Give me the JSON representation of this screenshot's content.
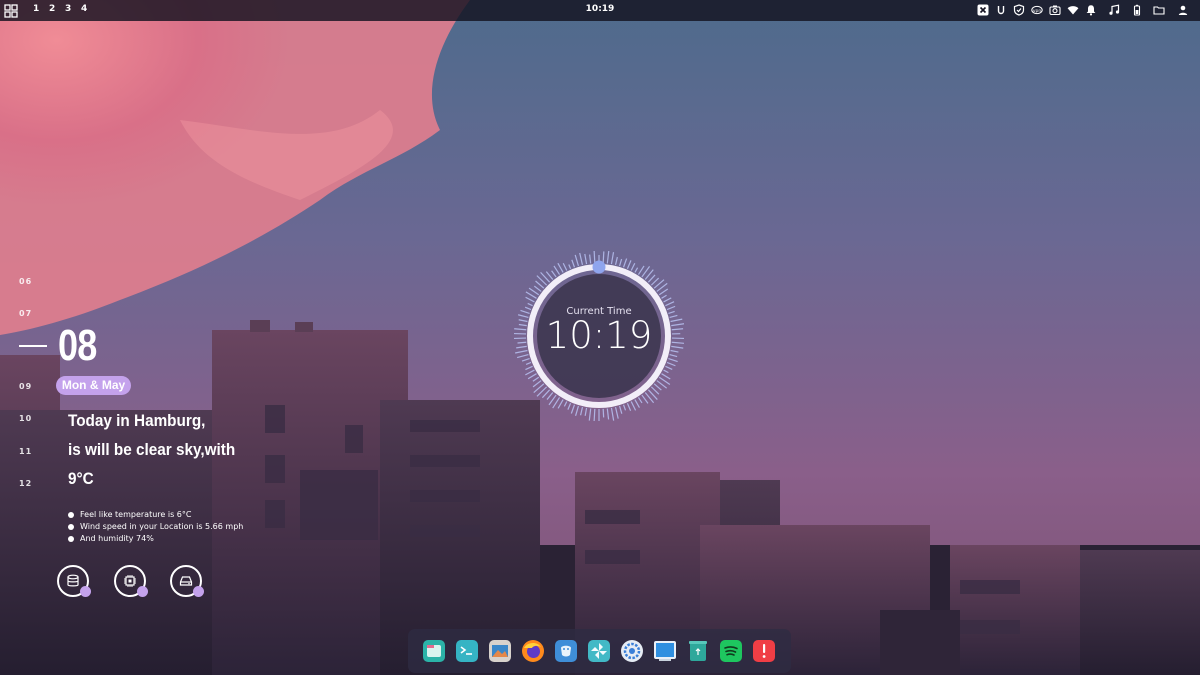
{
  "top_bar": {
    "workspaces": [
      "1",
      "2",
      "3",
      "4"
    ],
    "clock": "10:19",
    "tray_icons": [
      "x-app-icon",
      "u-app-icon",
      "shield-icon",
      "vpn-icon",
      "screenshot-icon",
      "wifi-icon",
      "bell-icon",
      "music-icon",
      "battery-icon",
      "folder-icon",
      "user-icon"
    ]
  },
  "calendar_widget": {
    "day_ticks": [
      "06",
      "07",
      "09",
      "10",
      "11",
      "12"
    ],
    "current_day": "08",
    "date_pill": "Mon & May",
    "headline": [
      "Today in Hamburg,",
      "is will be clear sky,with",
      "9°C"
    ],
    "details": [
      "Feel like temperature is 6°C",
      "Wind speed in your Location is 5.66 mph",
      "And humidity 74%"
    ],
    "stat_icons": [
      "database-icon",
      "cpu-icon",
      "disk-icon"
    ]
  },
  "clock_widget": {
    "label": "Current Time",
    "time": "10:19"
  },
  "dock": {
    "apps": [
      "file-manager-app",
      "terminal-app",
      "image-viewer-app",
      "firefox-app",
      "finder-app",
      "pinwheel-app",
      "settings-app",
      "desktop-app",
      "trash-app",
      "spotify-app",
      "alert-app"
    ]
  },
  "colors": {
    "accent": "#c4a2ec",
    "topbar": "#141220",
    "dock": "#2e2c42"
  }
}
